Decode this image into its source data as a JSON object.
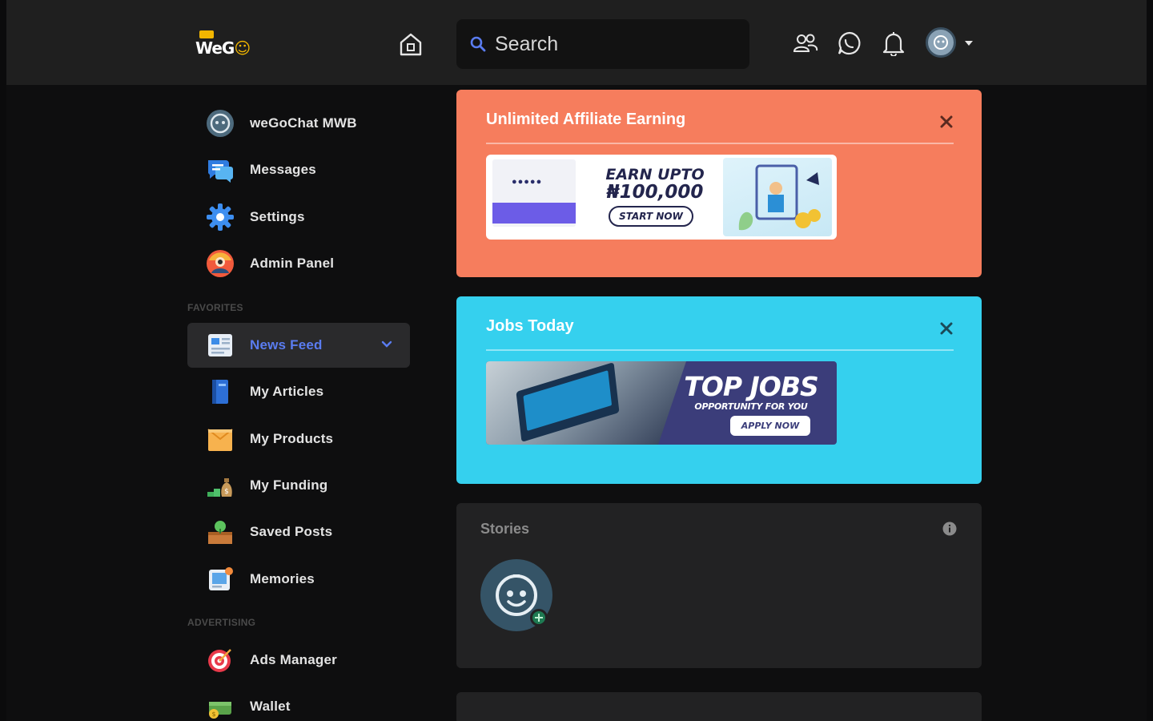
{
  "header": {
    "logo_text": "WeG",
    "search_placeholder": "Search"
  },
  "sidebar": {
    "top_items": [
      {
        "label": "weGoChat MWB",
        "icon": "profile-avatar-icon"
      },
      {
        "label": "Messages",
        "icon": "messages-icon"
      },
      {
        "label": "Settings",
        "icon": "settings-gear-icon"
      },
      {
        "label": "Admin Panel",
        "icon": "admin-panel-icon"
      }
    ],
    "favorites_label": "FAVORITES",
    "favorites": [
      {
        "label": "News Feed",
        "icon": "news-feed-icon",
        "active": true
      },
      {
        "label": "My Articles",
        "icon": "articles-book-icon"
      },
      {
        "label": "My Products",
        "icon": "products-box-icon"
      },
      {
        "label": "My Funding",
        "icon": "funding-money-icon"
      },
      {
        "label": "Saved Posts",
        "icon": "saved-posts-icon"
      },
      {
        "label": "Memories",
        "icon": "memories-icon"
      }
    ],
    "advertising_label": "ADVERTISING",
    "advertising": [
      {
        "label": "Ads Manager",
        "icon": "ads-target-icon"
      },
      {
        "label": "Wallet",
        "icon": "wallet-icon"
      }
    ]
  },
  "main": {
    "affiliate": {
      "title": "Unlimited Affiliate Earning",
      "banner_line1": "EARN UPTO",
      "banner_line2": "₦100,000",
      "banner_button": "START NOW"
    },
    "jobs": {
      "title": "Jobs Today",
      "banner_title": "TOP JOBS",
      "banner_subtitle": "OPPORTUNITY FOR YOU",
      "banner_button": "APPLY NOW"
    },
    "stories": {
      "title": "Stories"
    }
  },
  "colors": {
    "affiliate_bg": "#f67d5d",
    "jobs_bg": "#35d0ee",
    "active_link": "#5a7cf0",
    "topbar_bg": "#1f1f1f"
  }
}
